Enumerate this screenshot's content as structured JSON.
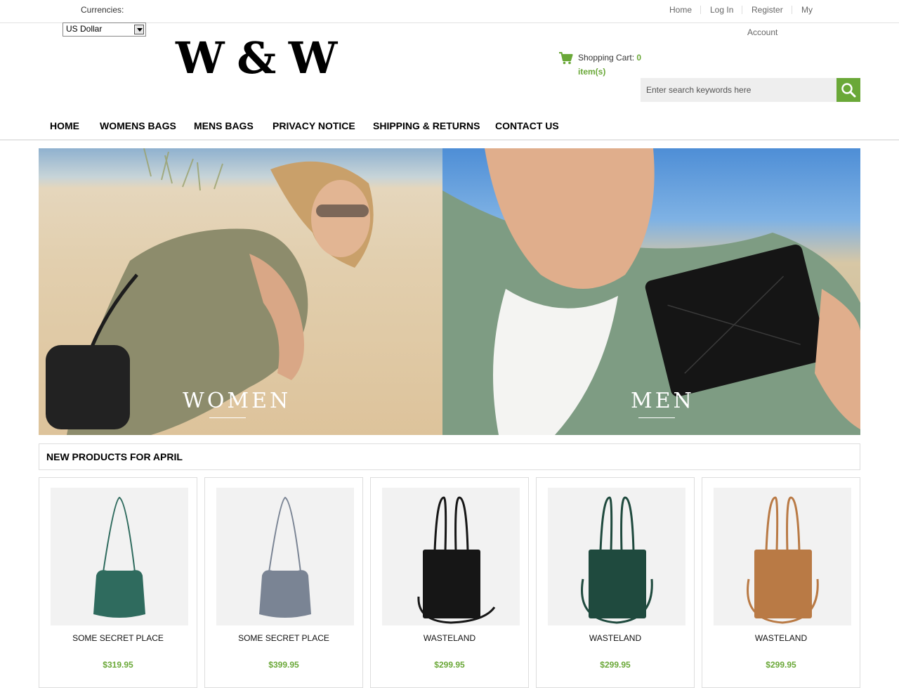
{
  "header": {
    "currencies_label": "Currencies:",
    "currency_selected": "US Dollar",
    "links": {
      "home": "Home",
      "login": "Log In",
      "register": "Register",
      "my": "My",
      "account": "Account"
    },
    "logo_text": "W & W",
    "cart": {
      "label": "Shopping Cart:",
      "count": "0",
      "items": "item(s)"
    },
    "search_placeholder": "Enter search keywords here"
  },
  "nav": [
    "HOME",
    "WOMENS BAGS",
    "MENS BAGS",
    "PRIVACY NOTICE",
    "SHIPPING & RETURNS",
    "CONTACT US"
  ],
  "banner": {
    "women": "WOMEN",
    "men": "MEN"
  },
  "section_title": "NEW PRODUCTS FOR APRIL",
  "products": [
    {
      "name": "SOME SECRET PLACE",
      "price": "$319.95",
      "color": "#2f6b5e"
    },
    {
      "name": "SOME SECRET PLACE",
      "price": "$399.95",
      "color": "#7a8494"
    },
    {
      "name": "WASTELAND",
      "price": "$299.95",
      "color": "#161616"
    },
    {
      "name": "WASTELAND",
      "price": "$299.95",
      "color": "#1f4a3e"
    },
    {
      "name": "WASTELAND",
      "price": "$299.95",
      "color": "#b97a45"
    }
  ],
  "colors": {
    "accent": "#6aa838"
  }
}
